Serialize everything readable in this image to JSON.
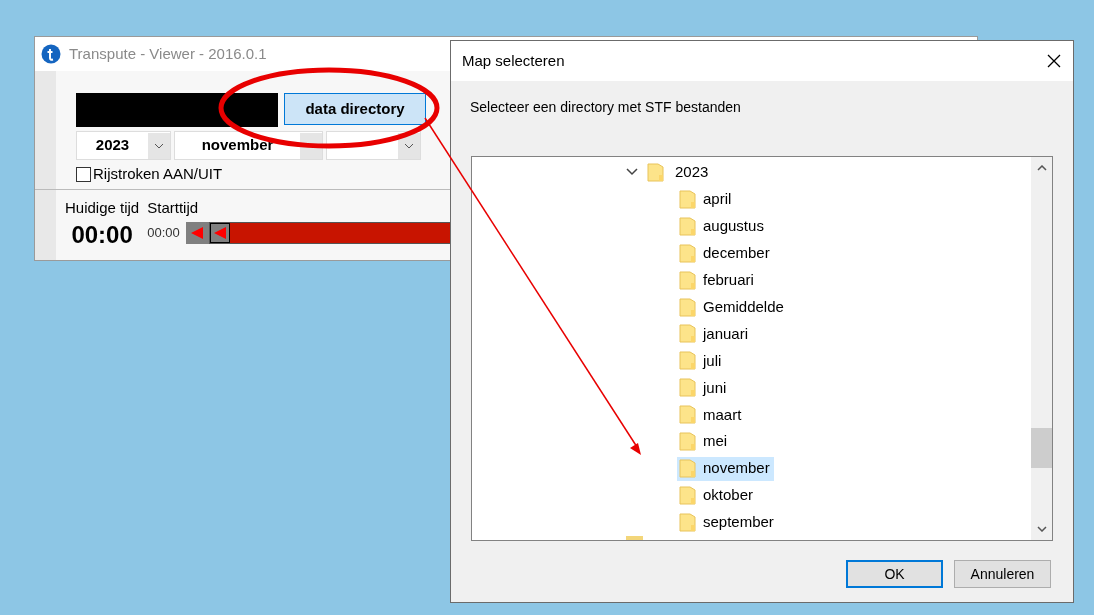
{
  "background_window": {
    "title": "Transpute - Viewer - 2016.0.1",
    "data_directory_button": "data directory",
    "year_combo": {
      "value": "2023"
    },
    "month_combo": {
      "value": "november"
    },
    "lanes_checkbox": {
      "label": "Rijstroken AAN/UIT",
      "checked": false
    },
    "current_time": {
      "label": "Huidige tijd",
      "value": "00:00"
    },
    "start_time": {
      "label": "Starttijd",
      "value": "00:00"
    },
    "time_slider": {
      "level": 0
    }
  },
  "dialog": {
    "title": "Map selecteren",
    "instruction": "Selecteer een directory met STF bestanden",
    "tree": [
      {
        "label": "2023",
        "expanded": true,
        "selected": false,
        "children": [
          {
            "label": "april",
            "selected": false
          },
          {
            "label": "augustus",
            "selected": false
          },
          {
            "label": "december",
            "selected": false
          },
          {
            "label": "februari",
            "selected": false
          },
          {
            "label": "Gemiddelde",
            "selected": false
          },
          {
            "label": "januari",
            "selected": false
          },
          {
            "label": "juli",
            "selected": false
          },
          {
            "label": "juni",
            "selected": false
          },
          {
            "label": "maart",
            "selected": false
          },
          {
            "label": "mei",
            "selected": false
          },
          {
            "label": "november",
            "selected": true
          },
          {
            "label": "oktober",
            "selected": false
          },
          {
            "label": "september",
            "selected": false
          }
        ]
      }
    ],
    "buttons": [
      {
        "label": "OK",
        "default": true
      },
      {
        "label": "Annuleren",
        "default": false
      }
    ]
  }
}
